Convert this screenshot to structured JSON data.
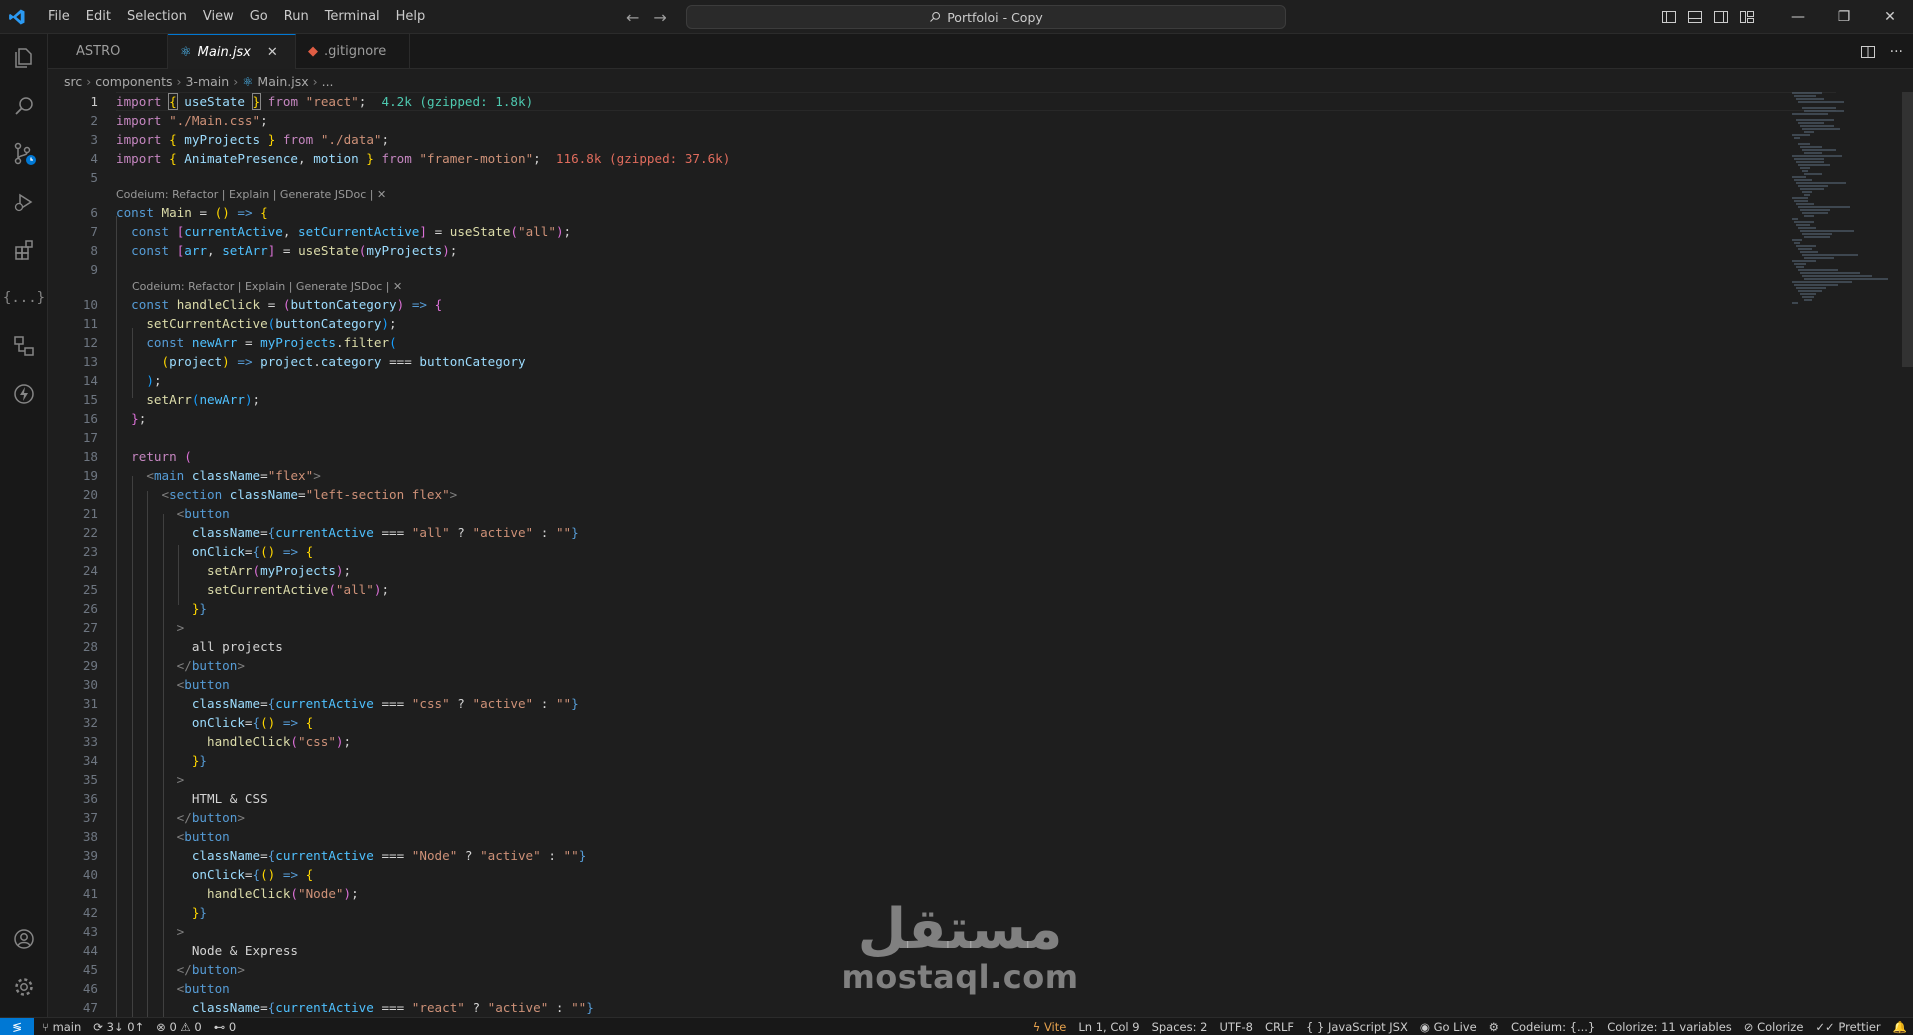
{
  "titlebar": {
    "menu": [
      "File",
      "Edit",
      "Selection",
      "View",
      "Go",
      "Run",
      "Terminal",
      "Help"
    ],
    "search_text": "Portfoloi - Copy"
  },
  "tabs": [
    {
      "label": "ASTRO",
      "active": false
    },
    {
      "label": "Main.jsx",
      "active": true
    },
    {
      "label": ".gitignore",
      "active": false
    }
  ],
  "breadcrumb": [
    "src",
    "components",
    "3-main",
    "Main.jsx",
    "..."
  ],
  "codelens": {
    "l6": "Codeium: Refactor | Explain | Generate JSDoc | ✕",
    "l10": "Codeium: Refactor | Explain | Generate JSDoc | ✕"
  },
  "imports": {
    "react_size": "4.2k (gzipped: 1.8k)",
    "framer_size": "116.8k (gzipped: 37.6k)"
  },
  "statusbar": {
    "branch": "main",
    "sync": "3↓ 0↑",
    "problems": "0 ⚠ 0",
    "ports": "0",
    "vite": "Vite",
    "position": "Ln 1, Col 9",
    "spaces": "Spaces: 2",
    "encoding": "UTF-8",
    "eol": "CRLF",
    "language": "JavaScript JSX",
    "golive": "Go Live",
    "codeium": "Codeium: {...}",
    "colorize_vars": "Colorize: 11 variables",
    "colorize": "Colorize",
    "prettier": "Prettier"
  },
  "watermark": {
    "arabic": "مستقل",
    "latin": "mostaql.com"
  },
  "colors": {
    "accent": "#0078d4",
    "editor_bg": "#1e1e1e",
    "vite": "#e5a14d"
  }
}
